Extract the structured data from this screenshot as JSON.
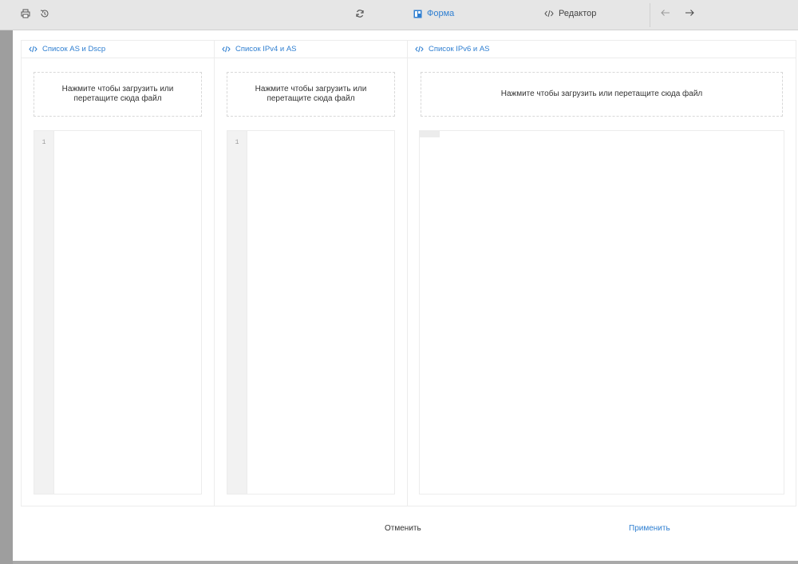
{
  "toolbar": {
    "form_label": "Форма",
    "editor_label": "Редактор"
  },
  "panels": [
    {
      "title": "Список AS и Dscp",
      "dropzone_text": "Нажмите чтобы загрузить или перетащите сюда файл",
      "line_numbers": "1"
    },
    {
      "title": "Список IPv4 и AS",
      "dropzone_text": "Нажмите чтобы загрузить или перетащите сюда файл",
      "line_numbers": "1"
    },
    {
      "title": "Список IPv6 и AS",
      "dropzone_text": "Нажмите чтобы загрузить или перетащите сюда файл"
    }
  ],
  "footer": {
    "cancel_label": "Отменить",
    "apply_label": "Применить"
  },
  "colors": {
    "accent": "#2f7fd1",
    "border": "#ececec",
    "gutter": "#f2f2f2"
  },
  "icons": [
    "print-icon",
    "history-icon",
    "refresh-icon",
    "form-icon",
    "code-icon",
    "arrow-left-icon",
    "arrow-right-icon"
  ]
}
